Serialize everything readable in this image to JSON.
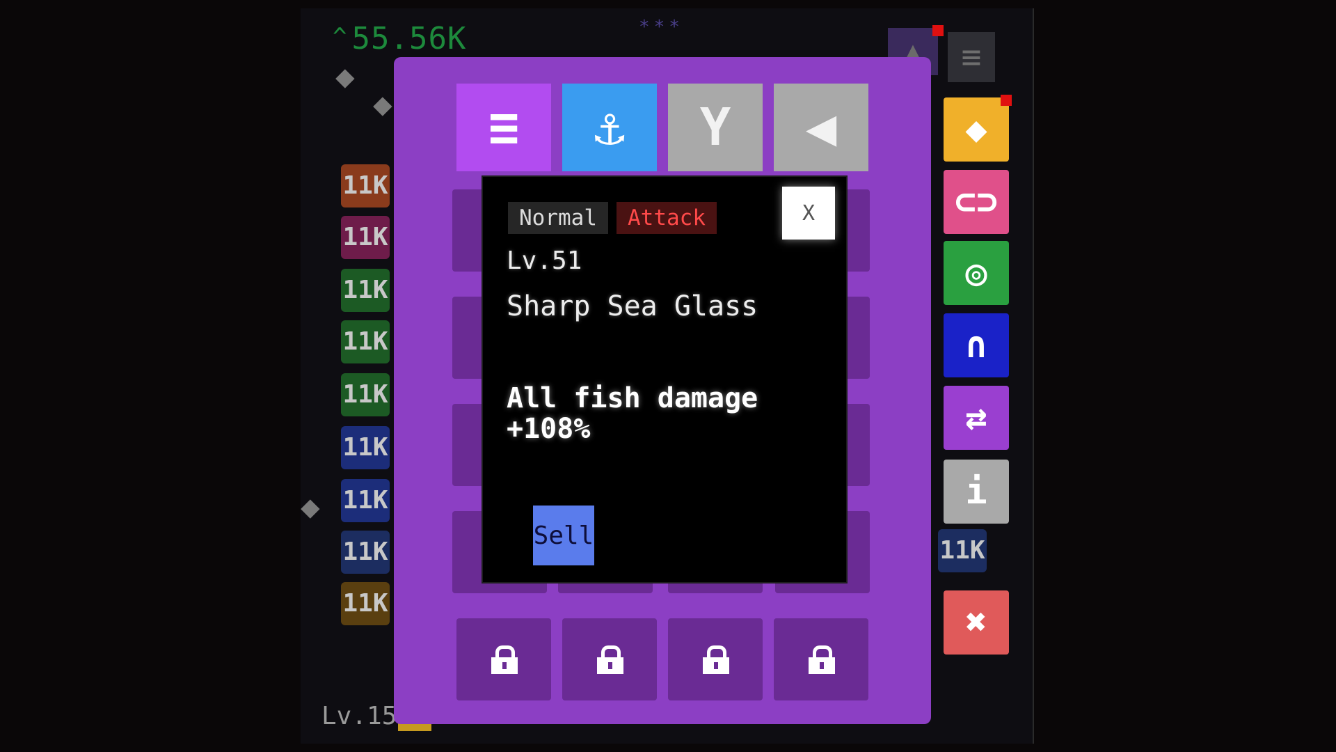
{
  "hud": {
    "money": "55.56K",
    "money_arrow": "^",
    "stars": "***",
    "level": "Lv.15"
  },
  "price_tags": [
    {
      "label": "11K",
      "color": "#8a3b1c"
    },
    {
      "label": "11K",
      "color": "#6e1c4a"
    },
    {
      "label": "11K",
      "color": "#1c5a24"
    },
    {
      "label": "11K",
      "color": "#1c5a24"
    },
    {
      "label": "11K",
      "color": "#1c5a24"
    },
    {
      "label": "11K",
      "color": "#1c2d7a"
    },
    {
      "label": "11K",
      "color": "#1c2d7a"
    },
    {
      "label": "11K",
      "color": "#1c2d60"
    },
    {
      "label": "11K",
      "color": "#5a3f10"
    }
  ],
  "right_tag": "11K",
  "tabs": [
    {
      "icon": "ladder-icon",
      "glyph": "≡",
      "color": "#b24cf0"
    },
    {
      "icon": "anchor-icon",
      "glyph": "⚓",
      "color": "#3a9cf0"
    },
    {
      "icon": "tail-fin-icon",
      "glyph": "Y",
      "color": "#a9a9a9"
    },
    {
      "icon": "megaphone-icon",
      "glyph": "◀",
      "color": "#a9a9a9"
    }
  ],
  "side_buttons": [
    {
      "icon": "fish-icon",
      "glyph": "◆",
      "color": "#f0b02a"
    },
    {
      "icon": "link-icon",
      "glyph": "⊂⊃",
      "color": "#e0508a"
    },
    {
      "icon": "target-icon",
      "glyph": "◎",
      "color": "#2aa040"
    },
    {
      "icon": "arch-icon",
      "glyph": "∩",
      "color": "#1a22c8"
    },
    {
      "icon": "swap-icon",
      "glyph": "⇄",
      "color": "#9a3fd0"
    },
    {
      "icon": "info-icon",
      "glyph": "i",
      "color": "#a9a9a9"
    },
    {
      "icon": "close-icon",
      "glyph": "✖",
      "color": "#e05a5a"
    }
  ],
  "menu_icon_glyph": "≡",
  "home_icon_glyph": "▲",
  "item": {
    "type_normal": "Normal",
    "type_attack": "Attack",
    "close_label": "X",
    "level": "Lv.51",
    "name": "Sharp Sea Glass",
    "description": "All fish damage\n+108%",
    "sell_label": "Sell"
  }
}
